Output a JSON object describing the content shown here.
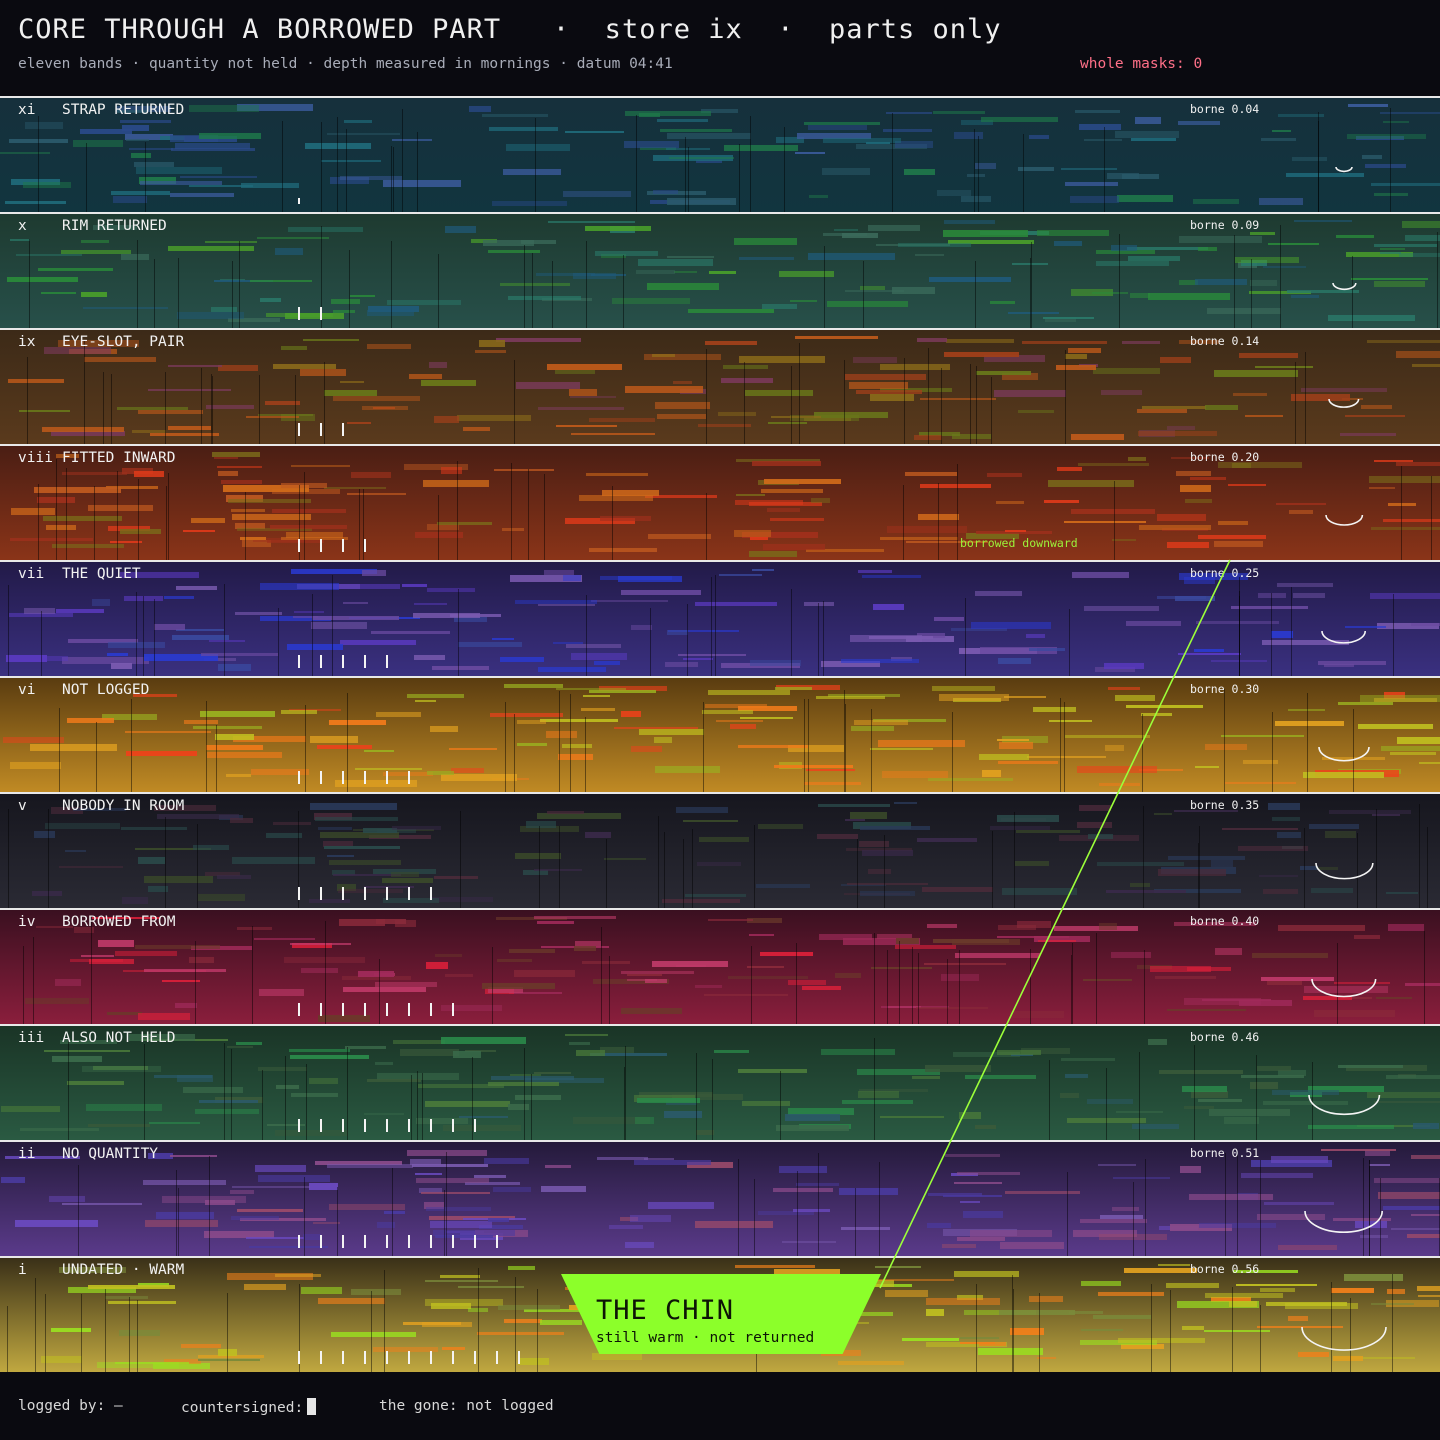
{
  "header": {
    "title": "CORE THROUGH A BORROWED PART   ·  store ix  ·  parts only",
    "subtitle": "eleven bands · quantity not held · depth measured in mornings · datum 04:41",
    "masks": "whole masks: 0"
  },
  "bands": [
    {
      "numeral": "xi",
      "name": "STRAP RETURNED",
      "borne": "borne 0.04",
      "ticks": 1,
      "colors": [
        "#16303c",
        "#11353f"
      ],
      "palette": [
        "#2a5a6a",
        "#1f6a7a",
        "#2a4a8a",
        "#1f7a4a",
        "#3a5a9a"
      ]
    },
    {
      "numeral": "x",
      "name": "RIM RETURNED",
      "borne": "borne 0.09",
      "ticks": 2,
      "colors": [
        "#1e3a30",
        "#27504a"
      ],
      "palette": [
        "#2a8a3a",
        "#3a6a5a",
        "#1f5a7a",
        "#4aa02a",
        "#2a7a6a"
      ]
    },
    {
      "numeral": "ix",
      "name": "EYE-SLOT, PAIR",
      "borne": "borne 0.14",
      "ticks": 3,
      "colors": [
        "#3c2a18",
        "#5a3a1c"
      ],
      "palette": [
        "#c05a1a",
        "#8a6a1a",
        "#a0401a",
        "#6a7a1a",
        "#7a3a5a"
      ]
    },
    {
      "numeral": "viii",
      "name": "FITTED INWARD",
      "borne": "borne 0.20",
      "ticks": 4,
      "colors": [
        "#4a1e14",
        "#8a3418"
      ],
      "palette": [
        "#e03a1a",
        "#c05a20",
        "#7a6a1a",
        "#a0301c",
        "#d06a1a"
      ]
    },
    {
      "numeral": "vii",
      "name": "THE QUIET",
      "borne": "borne 0.25",
      "ticks": 5,
      "colors": [
        "#221a48",
        "#3a3080"
      ],
      "palette": [
        "#5a3ac0",
        "#3a4aa0",
        "#7a5ab0",
        "#2a3ad0",
        "#6a4aa0"
      ]
    },
    {
      "numeral": "vi",
      "name": "NOT LOGGED",
      "borne": "borne 0.30",
      "ticks": 6,
      "colors": [
        "#5a3c10",
        "#c08a24"
      ],
      "palette": [
        "#f07a1a",
        "#c0c020",
        "#e0a020",
        "#9ab020",
        "#f0401a"
      ]
    },
    {
      "numeral": "v",
      "name": "NOBODY IN ROOM",
      "borne": "borne 0.35",
      "ticks": 7,
      "colors": [
        "#16161e",
        "#2a2a34"
      ],
      "palette": [
        "#2a4a4a",
        "#3a2a4a",
        "#2a3a5a",
        "#3a4a2a",
        "#4a2a3a"
      ]
    },
    {
      "numeral": "iv",
      "name": "BORROWED FROM",
      "borne": "borne 0.40",
      "ticks": 8,
      "colors": [
        "#3a1020",
        "#8a1e3c"
      ],
      "palette": [
        "#e0203a",
        "#a02a5a",
        "#6a3a2a",
        "#c03a6a",
        "#8a2a3a"
      ]
    },
    {
      "numeral": "iii",
      "name": "ALSO NOT HELD",
      "borne": "borne 0.46",
      "ticks": 9,
      "colors": [
        "#1a3426",
        "#2a5a42"
      ],
      "palette": [
        "#2a8a4a",
        "#3a6a4a",
        "#2a5a6a",
        "#4a7a3a",
        "#3a5a3a"
      ]
    },
    {
      "numeral": "ii",
      "name": "NO QUANTITY",
      "borne": "borne 0.51",
      "ticks": 10,
      "colors": [
        "#241a3a",
        "#5a3a8a"
      ],
      "palette": [
        "#6a4ac0",
        "#8a4a8a",
        "#4a3aa0",
        "#7a5ab0",
        "#9a4a6a"
      ]
    },
    {
      "numeral": "i",
      "name": "UNDATED · WARM",
      "borne": "borne 0.56",
      "ticks": 11,
      "colors": [
        "#3a3018",
        "#c0a840"
      ],
      "palette": [
        "#e0a020",
        "#9ae020",
        "#c0c020",
        "#f0801a",
        "#7a8a3a"
      ]
    }
  ],
  "annotation": "borrowed downward",
  "chin": {
    "title": "THE CHIN",
    "subtitle": "still warm · not returned",
    "color": "#8cff2a"
  },
  "footer": {
    "logged_by": "logged by: —",
    "countersigned": "countersigned:",
    "gone": "the gone: not logged"
  }
}
